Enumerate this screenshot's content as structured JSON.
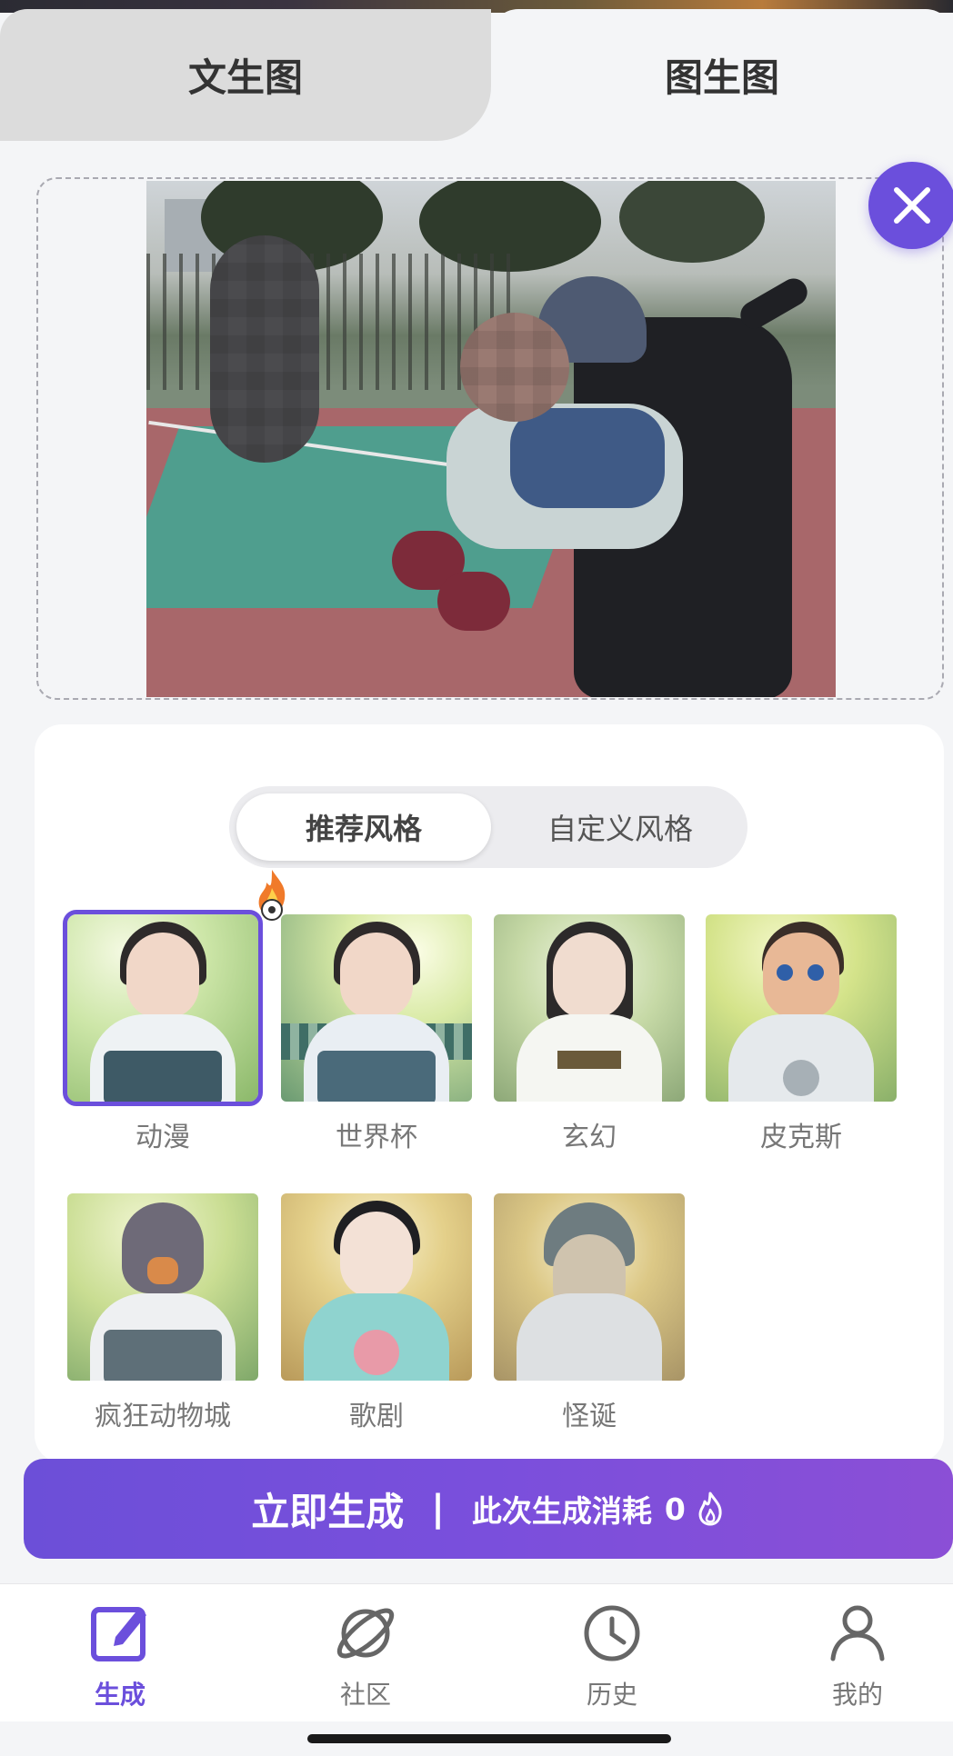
{
  "tabs": {
    "text_to_image": "文生图",
    "image_to_image": "图生图",
    "active": "image_to_image"
  },
  "upload": {
    "close_icon": "close-icon"
  },
  "style_segment": {
    "recommended": "推荐风格",
    "custom": "自定义风格",
    "active": "recommended"
  },
  "styles": [
    {
      "label": "动漫",
      "selected": true,
      "hot": true
    },
    {
      "label": "世界杯",
      "selected": false
    },
    {
      "label": "玄幻",
      "selected": false
    },
    {
      "label": "皮克斯",
      "selected": false
    },
    {
      "label": "疯狂动物城",
      "selected": false
    },
    {
      "label": "歌剧",
      "selected": false
    },
    {
      "label": "怪诞",
      "selected": false
    }
  ],
  "generate": {
    "label": "立即生成",
    "separator": "|",
    "cost_label": "此次生成消耗",
    "cost_value": "0",
    "cost_icon": "flame-icon"
  },
  "nav": [
    {
      "label": "生成",
      "icon": "edit-icon",
      "active": true
    },
    {
      "label": "社区",
      "icon": "planet-icon",
      "active": false
    },
    {
      "label": "历史",
      "icon": "clock-icon",
      "active": false
    },
    {
      "label": "我的",
      "icon": "user-icon",
      "active": false
    }
  ],
  "colors": {
    "accent": "#6b4fdc",
    "background": "#f4f5f7"
  }
}
